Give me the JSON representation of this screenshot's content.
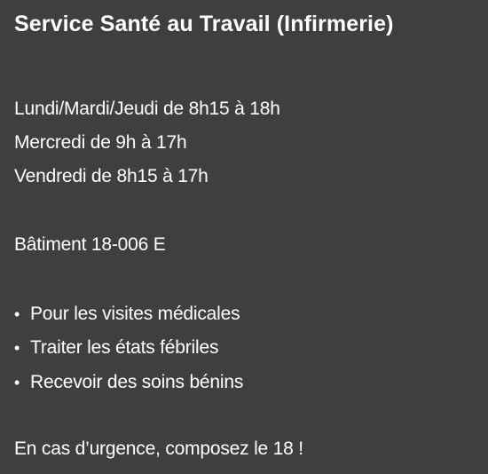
{
  "title": "Service Santé au Travail (Infirmerie)",
  "hours": [
    "Lundi/Mardi/Jeudi de 8h15 à 18h",
    "Mercredi de 9h à 17h",
    "Vendredi de 8h15 à 17h"
  ],
  "building": "Bâtiment 18-006 E",
  "services": [
    "Pour les visites médicales",
    "Traiter les états fébriles",
    "Recevoir des soins bénins"
  ],
  "bullet_symbol": "•",
  "emergency": "En cas d’urgence, composez le 18 !",
  "colors": {
    "background": "#3f3f3f",
    "text": "#ffffff"
  }
}
